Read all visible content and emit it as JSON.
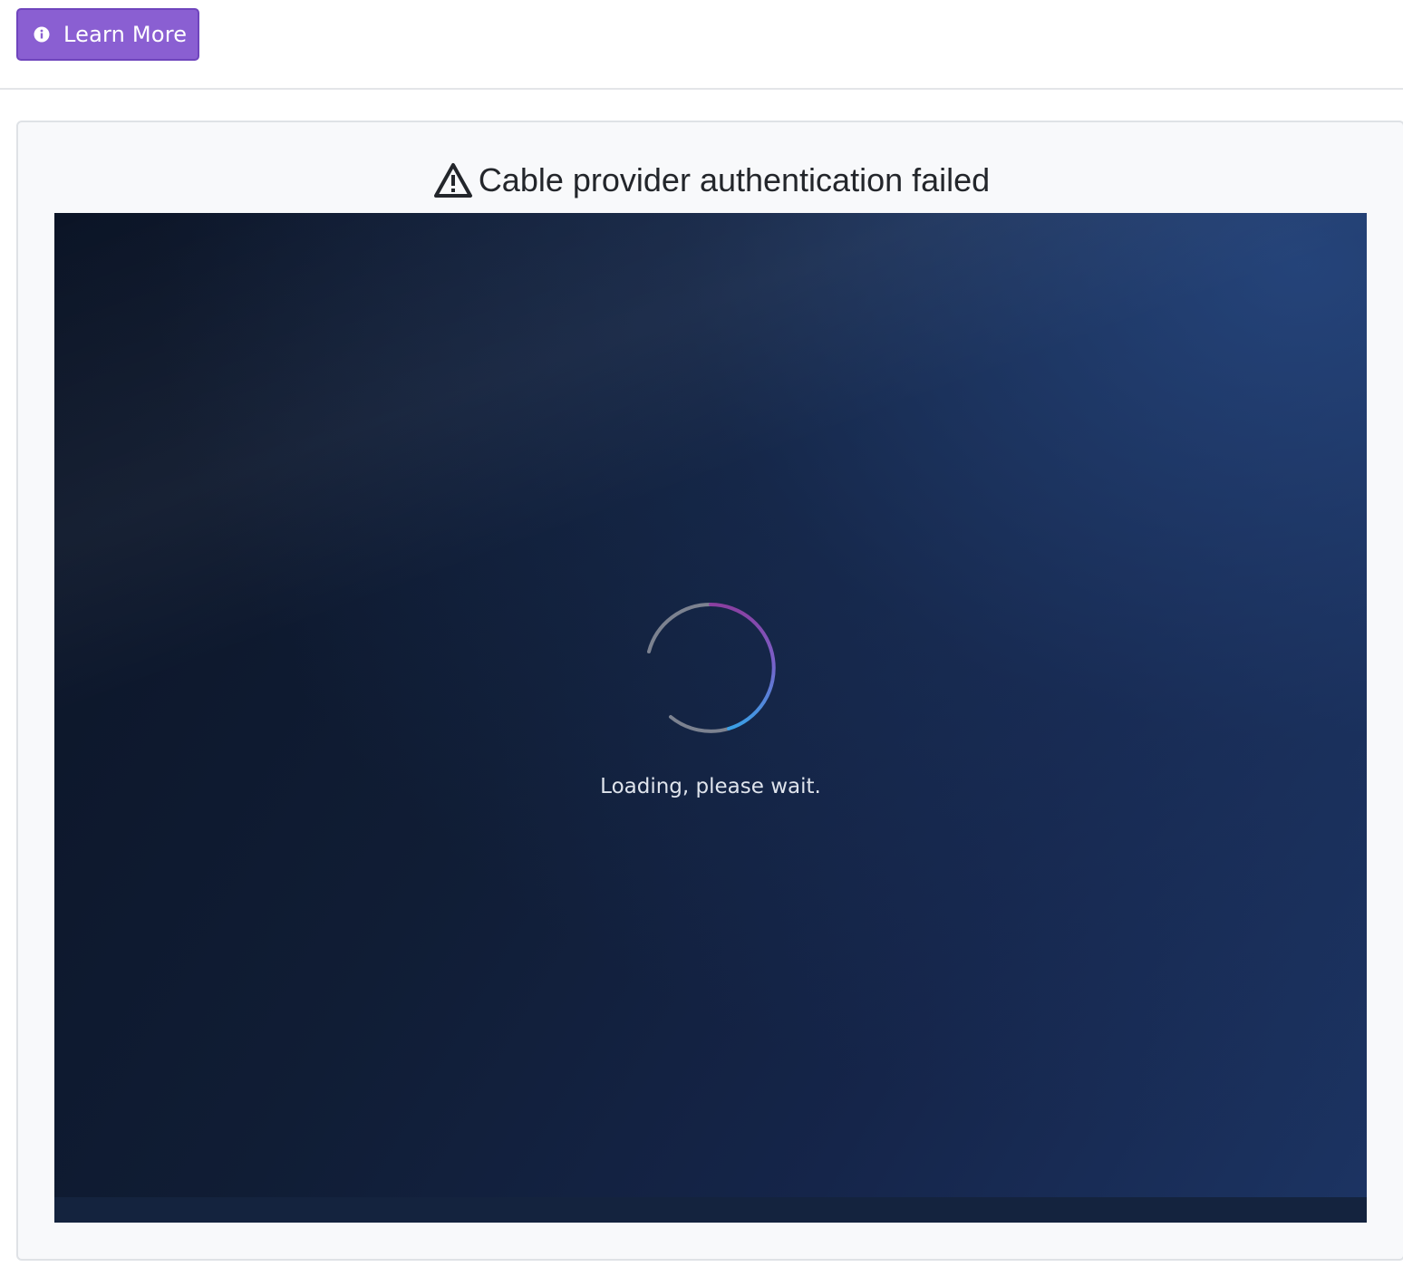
{
  "toolbar": {
    "learn_more_label": "Learn More",
    "learn_more_icon": "info-circle-icon",
    "button_color": "#8a5fd2"
  },
  "panel": {
    "title": "Cable provider authentication failed",
    "title_icon": "warning-triangle-icon"
  },
  "player": {
    "loading_text": "Loading, please wait.",
    "spinner_icon": "loading-spinner-icon",
    "background_color": "#101d35"
  }
}
